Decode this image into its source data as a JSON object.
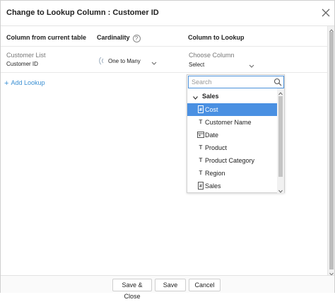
{
  "dialog": {
    "title": "Change to Lookup Column : Customer ID"
  },
  "columns": {
    "from_header": "Column from current table",
    "cardinality_header": "Cardinality",
    "lookup_header": "Column to Lookup"
  },
  "row": {
    "table_name": "Customer List",
    "column_name": "Customer ID",
    "cardinality_value": "One to Many",
    "choose_label": "Choose Column",
    "choose_value": "Select"
  },
  "add_lookup": "Add Lookup",
  "dropdown": {
    "search_placeholder": "Search",
    "group_label": "Sales",
    "items": [
      {
        "label": "Cost",
        "icon": "number-icon",
        "selected": true
      },
      {
        "label": "Customer Name",
        "icon": "text-type-icon",
        "selected": false
      },
      {
        "label": "Date",
        "icon": "calendar-icon",
        "selected": false
      },
      {
        "label": "Product",
        "icon": "text-type-icon",
        "selected": false
      },
      {
        "label": "Product Category",
        "icon": "text-type-icon",
        "selected": false
      },
      {
        "label": "Region",
        "icon": "text-type-icon",
        "selected": false
      },
      {
        "label": "Sales",
        "icon": "number-icon",
        "selected": false
      }
    ]
  },
  "footer": {
    "save_close": "Save & Close",
    "save": "Save",
    "cancel": "Cancel"
  },
  "colors": {
    "accent": "#4a90e2",
    "link": "#3a8fd3"
  }
}
